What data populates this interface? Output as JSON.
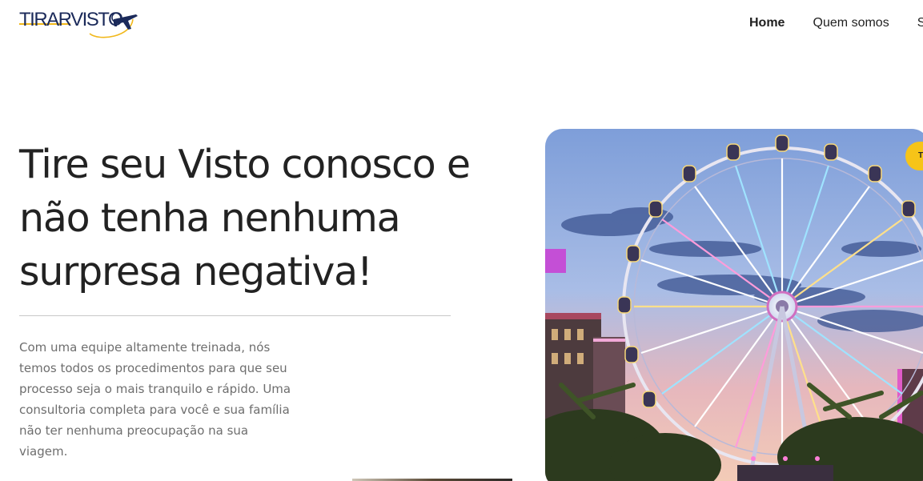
{
  "header": {
    "logo_text": "TIRARVISTO",
    "nav": [
      {
        "label": "Home",
        "active": true
      },
      {
        "label": "Quem somos",
        "active": false
      },
      {
        "label": "S",
        "active": false
      }
    ]
  },
  "hero": {
    "headline": "Tire seu Visto conosco e não tenha nenhuma surpresa negativa!",
    "paragraph": "Com uma equipe altamente treinada, nós temos todos os procedimentos para que seu processo seja o mais tranquilo e rápido. Uma consultoria completa para você e sua família não ter nenhuma preocupação na sua viagem.",
    "badge_text": "T",
    "image_description_icon": "ferris-wheel-photo"
  },
  "colors": {
    "accent_yellow": "#f6c418",
    "logo_navy": "#1b2a5a",
    "text_dark": "#222222",
    "text_muted": "#6e6e6e"
  }
}
